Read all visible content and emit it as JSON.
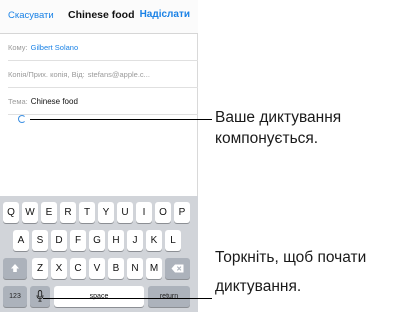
{
  "navbar": {
    "cancel_label": "Скасувати",
    "title": "Chinese food",
    "send_label": "Надіслати"
  },
  "fields": {
    "to_label": "Кому:",
    "to_value": "Gilbert Solano",
    "cc_label": "Копія/Прих. копія, Від:",
    "cc_value": "stefans@apple.c...",
    "subject_label": "Тема:",
    "subject_value": "Chinese food"
  },
  "keyboard": {
    "row1": [
      "Q",
      "W",
      "E",
      "R",
      "T",
      "Y",
      "U",
      "I",
      "O",
      "P"
    ],
    "row2": [
      "A",
      "S",
      "D",
      "F",
      "G",
      "H",
      "J",
      "K",
      "L"
    ],
    "row3": [
      "Z",
      "X",
      "C",
      "V",
      "B",
      "N",
      "M"
    ],
    "shift_icon": "shift-arrow-icon",
    "delete_icon": "backspace-icon",
    "numbers_label": "123",
    "mic_icon": "microphone-icon",
    "space_label": "space",
    "return_label": "return"
  },
  "callouts": {
    "dictation_line1": "Ваше диктування",
    "dictation_line2": "компонується.",
    "tap_line1": "Торкніть, щоб почати",
    "tap_line2": "диктування."
  },
  "colors": {
    "accent": "#1a82e6",
    "keyboard_bg": "#d1d4d9",
    "function_key": "#acb2bb"
  }
}
